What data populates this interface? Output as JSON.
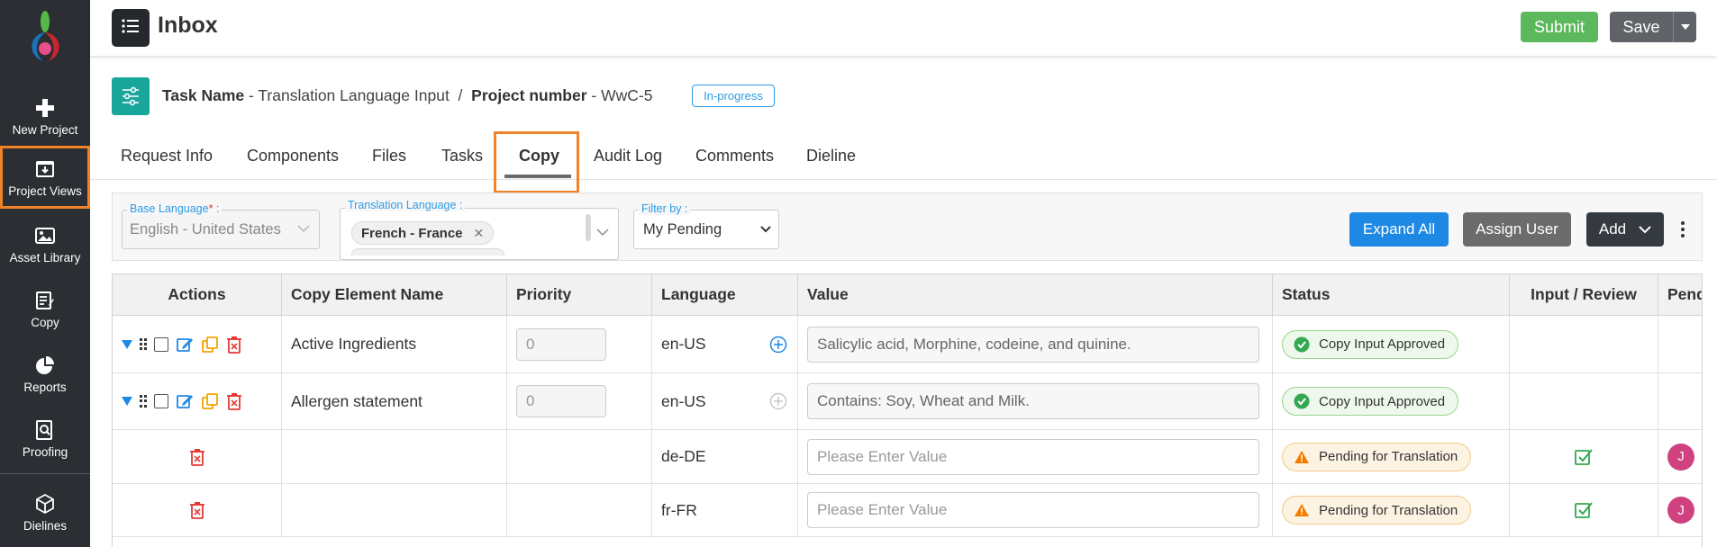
{
  "sidebar": {
    "items": [
      {
        "label": "New Project",
        "icon": "plus-icon"
      },
      {
        "label": "Project Views",
        "icon": "inbox-download-icon",
        "active": true
      },
      {
        "label": "Asset Library",
        "icon": "image-icon"
      },
      {
        "label": "Copy",
        "icon": "copy-document-icon"
      },
      {
        "label": "Reports",
        "icon": "pie-chart-icon"
      },
      {
        "label": "Proofing",
        "icon": "proof-search-icon"
      },
      {
        "label": "Dielines",
        "icon": "cube-icon"
      }
    ]
  },
  "header": {
    "title": "Inbox",
    "submit_label": "Submit",
    "save_label": "Save"
  },
  "task": {
    "task_name_label": "Task Name",
    "task_name_value": "Translation Language Input",
    "separator": "/",
    "project_number_label": "Project number",
    "project_number_value": "WwC-5",
    "status": "In-progress"
  },
  "tabs": [
    {
      "label": "Request Info"
    },
    {
      "label": "Components"
    },
    {
      "label": "Files"
    },
    {
      "label": "Tasks"
    },
    {
      "label": "Copy",
      "active": true
    },
    {
      "label": "Audit Log"
    },
    {
      "label": "Comments"
    },
    {
      "label": "Dieline"
    }
  ],
  "filters": {
    "base_language_label": "Base Language",
    "base_language_value": "English - United States",
    "translation_language_label": "Translation Language :",
    "translation_chip": "French - France",
    "filter_by_label": "Filter by :",
    "filter_by_value": "My Pending",
    "expand_label": "Expand All",
    "assign_label": "Assign User",
    "add_label": "Add"
  },
  "table": {
    "headers": {
      "actions": "Actions",
      "name": "Copy Element Name",
      "priority": "Priority",
      "language": "Language",
      "value": "Value",
      "status": "Status",
      "input_review": "Input / Review",
      "pending": "Pend"
    },
    "rows": [
      {
        "name": "Active Ingredients",
        "priority": "0",
        "language": "en-US",
        "value": "Salicylic acid, Morphine, codeine, and quinine.",
        "status": "Copy Input Approved"
      },
      {
        "name": "Allergen statement",
        "priority": "0",
        "language": "en-US",
        "value": "Contains: Soy, Wheat and Milk.",
        "status": "Copy Input Approved"
      },
      {
        "name": "",
        "priority": "",
        "language": "de-DE",
        "value_placeholder": "Please Enter Value",
        "status": "Pending for Translation",
        "avatar": "J"
      },
      {
        "name": "",
        "priority": "",
        "language": "fr-FR",
        "value_placeholder": "Please Enter Value",
        "status": "Pending for Translation",
        "avatar": "J"
      }
    ]
  },
  "colors": {
    "sidebar_bg": "#2b2e33",
    "active_outline": "#f08229",
    "accent_blue": "#1e88e5",
    "submit_green": "#5cb85c",
    "status_ok": "#9ad58e",
    "status_warn": "#f3c98a",
    "avatar_pink": "#d0417f"
  }
}
